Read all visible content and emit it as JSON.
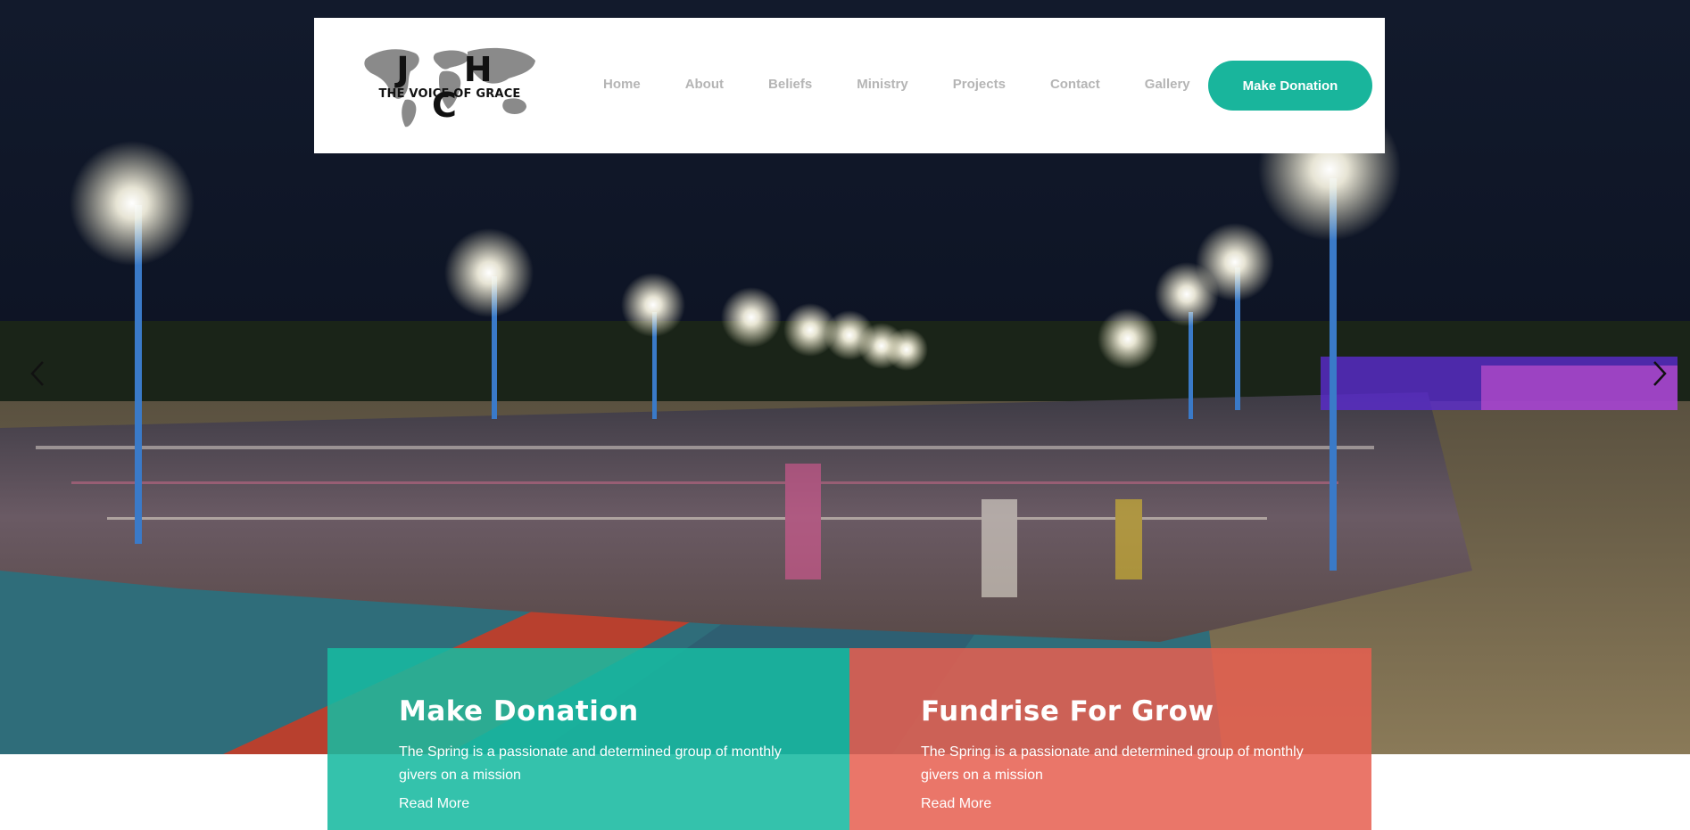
{
  "brand": {
    "logo_letters": "J H C",
    "logo_tagline": "THE VOICE OF GRACE"
  },
  "nav": {
    "items": [
      {
        "label": "Home"
      },
      {
        "label": "About"
      },
      {
        "label": "Beliefs"
      },
      {
        "label": "Ministry"
      },
      {
        "label": "Projects"
      },
      {
        "label": "Contact"
      },
      {
        "label": "Gallery"
      }
    ],
    "cta_label": "Make Donation"
  },
  "slider": {
    "prev_icon": "chevron-left-icon",
    "next_icon": "chevron-right-icon"
  },
  "promos": [
    {
      "title": "Make Donation",
      "text": "The Spring is a passionate and determined group of monthly givers on a mission",
      "link": "Read More",
      "color": "#18baa0"
    },
    {
      "title": "Fundrise For Grow",
      "text": "The Spring is a passionate and determined group of monthly givers on a mission",
      "link": "Read More",
      "color": "#e75f50"
    }
  ],
  "colors": {
    "accent": "#19b59c",
    "nav_text": "#b5b5b5",
    "secondary": "#e75f50"
  }
}
